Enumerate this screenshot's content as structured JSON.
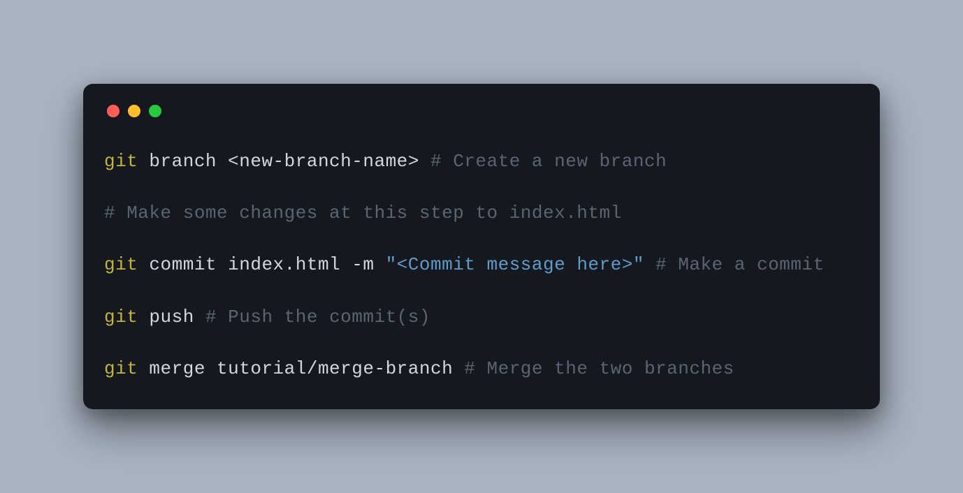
{
  "colors": {
    "background": "#a9b4c2",
    "terminal_bg": "#15181f",
    "traffic_red": "#ff5f56",
    "traffic_yellow": "#ffbd2e",
    "traffic_green": "#27c93f",
    "cmd": "#c3b43e",
    "text": "#d4d7dc",
    "string": "#5f9cc9",
    "comment": "#5b6472"
  },
  "lines": {
    "l1": {
      "cmd": "git",
      "text": " branch <new-branch-name> ",
      "comment": "# Create a new branch"
    },
    "l2": {
      "comment": "# Make some changes at this step to index.html"
    },
    "l3": {
      "cmd": "git",
      "text1": " commit index.html ",
      "flag": "-m ",
      "string": "\"<Commit message here>\"",
      "text2": " ",
      "comment": "# Make a commit"
    },
    "l4": {
      "cmd": "git",
      "text": " push ",
      "comment": "# Push the commit(s)"
    },
    "l5": {
      "cmd": "git",
      "text": " merge tutorial/merge-branch ",
      "comment": "# Merge the two branches"
    }
  }
}
